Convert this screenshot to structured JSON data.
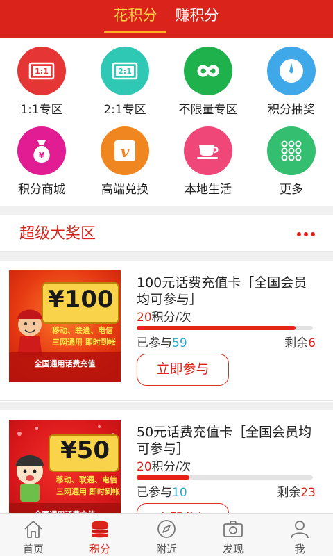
{
  "header": {
    "tabs": [
      {
        "label": "花积分",
        "active": true
      },
      {
        "label": "赚积分",
        "active": false
      }
    ]
  },
  "categories": [
    {
      "label": "1:1专区",
      "icon": "ticket-1-1-icon",
      "color": "#e63535",
      "badge": "1:1"
    },
    {
      "label": "2:1专区",
      "icon": "ticket-2-1-icon",
      "color": "#2fc8b4",
      "badge": "2:1"
    },
    {
      "label": "不限量专区",
      "icon": "infinity-icon",
      "color": "#1fb14b"
    },
    {
      "label": "积分抽奖",
      "icon": "dial-icon",
      "color": "#3fa8e8"
    },
    {
      "label": "积分商城",
      "icon": "money-bag-icon",
      "color": "#e21d93",
      "badge": "¥"
    },
    {
      "label": "高端兑换",
      "icon": "v-badge-icon",
      "color": "#f0861f",
      "badge": "v"
    },
    {
      "label": "本地生活",
      "icon": "coffee-cup-icon",
      "color": "#ef4777"
    },
    {
      "label": "更多",
      "icon": "grid-dots-icon",
      "color": "#33bf6f"
    }
  ],
  "section": {
    "title": "超级大奖区",
    "more_icon": "more-dots-icon"
  },
  "prizes": [
    {
      "name": "100元话费充值卡［全国会员均可参与］",
      "cost_num": "20",
      "cost_unit": "积分/次",
      "progress": 0.9,
      "joined_label": "已参与",
      "joined": "59",
      "remaining_label": "剩余",
      "remaining": "6",
      "button": "立即参与",
      "image": {
        "price": "¥100",
        "line1": "移动、联通、电信",
        "line2": "三网通用  即时到帐",
        "footer": "全国通用话费充值"
      }
    },
    {
      "name": "50元话费充值卡［全国会员均可参与］",
      "cost_num": "20",
      "cost_unit": "积分/次",
      "progress": 0.3,
      "joined_label": "已参与",
      "joined": "10",
      "remaining_label": "剩余",
      "remaining": "23",
      "button": "立即参与",
      "image": {
        "price": "¥50",
        "line1": "移动、联通、电信",
        "line2": "三网通用  即时到帐",
        "footer": "全国通用话费充值"
      }
    }
  ],
  "bottom_nav": [
    {
      "label": "首页",
      "icon": "home-icon",
      "active": false
    },
    {
      "label": "积分",
      "icon": "coins-icon",
      "active": true
    },
    {
      "label": "附近",
      "icon": "compass-icon",
      "active": false
    },
    {
      "label": "发现",
      "icon": "camera-icon",
      "active": false
    },
    {
      "label": "我",
      "icon": "user-icon",
      "active": false
    }
  ],
  "colors": {
    "brand_red": "#d9231b",
    "active_tab": "#ffd24a",
    "joined_blue": "#2aa6c9"
  }
}
